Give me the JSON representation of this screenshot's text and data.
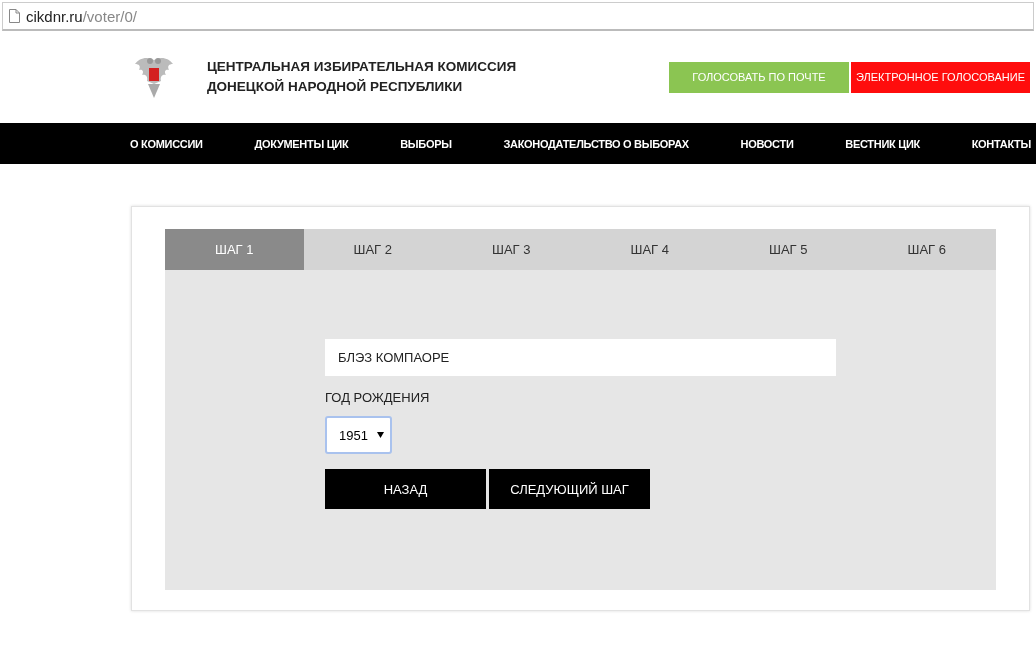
{
  "browser": {
    "url_domain": "cikdnr.ru",
    "url_path": "/voter/0/"
  },
  "header": {
    "title_lines": [
      "ЦЕНТРАЛЬНАЯ ИЗБИРАТЕЛЬНАЯ КОМИССИЯ",
      "ДОНЕЦКОЙ НАРОДНОЙ РЕСПУБЛИКИ"
    ],
    "buttons": [
      {
        "label": "ГОЛОСОВАТЬ ПО ПОЧТЕ",
        "color": "#8bc552"
      },
      {
        "label": "ЭЛЕКТРОННОЕ ГОЛОСОВАНИЕ",
        "color": "#ff0d0d"
      }
    ]
  },
  "nav": [
    "О КОМИССИИ",
    "ДОКУМЕНТЫ ЦИК",
    "ВЫБОРЫ",
    "ЗАКОНОДАТЕЛЬСТВО О ВЫБОРАХ",
    "НОВОСТИ",
    "ВЕСТНИК ЦИК",
    "КОНТАКТЫ"
  ],
  "steps": [
    {
      "label": "ШАГ 1",
      "selected": true
    },
    {
      "label": "ШАГ 2",
      "selected": false
    },
    {
      "label": "ШАГ 3",
      "selected": false
    },
    {
      "label": "ШАГ 4",
      "selected": false
    },
    {
      "label": "ШАГ 5",
      "selected": false
    },
    {
      "label": "ШАГ 6",
      "selected": false
    }
  ],
  "form": {
    "name_value": "БЛЭЗ КОМПАОРЕ",
    "year_label": "ГОД РОЖДЕНИЯ",
    "year_value": "1951",
    "buttons": [
      "НАЗАД",
      "СЛЕДУЮЩИЙ ШАГ"
    ]
  }
}
